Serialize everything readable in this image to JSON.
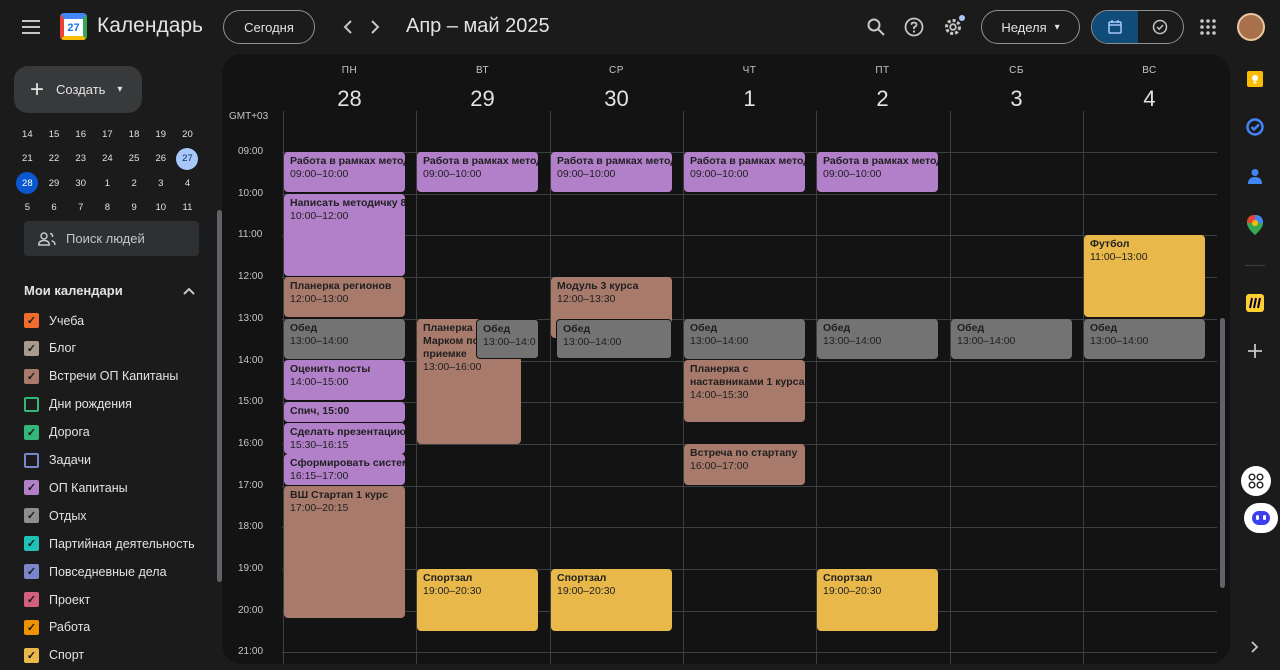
{
  "header": {
    "app_title": "Календарь",
    "logo_number": "27",
    "today_button": "Сегодня",
    "date_range": "Апр – май 2025",
    "view_button": "Неделя",
    "view_arrow": "▾"
  },
  "create_button": {
    "label": "Создать",
    "arrow": "▾"
  },
  "mini_calendar": {
    "rows": [
      [
        "14",
        "15",
        "16",
        "17",
        "18",
        "19",
        "20"
      ],
      [
        "21",
        "22",
        "23",
        "24",
        "25",
        "26",
        "27"
      ],
      [
        "28",
        "29",
        "30",
        "1",
        "2",
        "3",
        "4"
      ],
      [
        "5",
        "6",
        "7",
        "8",
        "9",
        "10",
        "11"
      ]
    ],
    "selected": "27",
    "today": "28"
  },
  "people_search": {
    "placeholder": "Поиск людей"
  },
  "my_calendars": {
    "title": "Мои календари",
    "items": [
      {
        "label": "Учеба",
        "color": "#ef6c2d",
        "checked": true
      },
      {
        "label": "Блог",
        "color": "#a79b8e",
        "checked": true
      },
      {
        "label": "Встречи ОП Капитаны",
        "color": "#a87a6c",
        "checked": true
      },
      {
        "label": "Дни рождения",
        "color": "#33b679",
        "checked": false
      },
      {
        "label": "Дорога",
        "color": "#33b679",
        "checked": true
      },
      {
        "label": "Задачи",
        "color": "#7986cb",
        "checked": false
      },
      {
        "label": "ОП Капитаны",
        "color": "#b180c9",
        "checked": true
      },
      {
        "label": "Отдых",
        "color": "#8e8e8e",
        "checked": true
      },
      {
        "label": "Партийная деятельность",
        "color": "#20c2b5",
        "checked": true
      },
      {
        "label": "Повседневные дела",
        "color": "#7986cb",
        "checked": true
      },
      {
        "label": "Проект",
        "color": "#d25f7e",
        "checked": true
      },
      {
        "label": "Работа",
        "color": "#f09300",
        "checked": true
      },
      {
        "label": "Спорт",
        "color": "#e8b84b",
        "checked": true
      }
    ]
  },
  "week": {
    "timezone": "GMT+03",
    "days": [
      {
        "name": "ПН",
        "date": "28"
      },
      {
        "name": "ВТ",
        "date": "29"
      },
      {
        "name": "СР",
        "date": "30"
      },
      {
        "name": "ЧТ",
        "date": "1"
      },
      {
        "name": "ПТ",
        "date": "2"
      },
      {
        "name": "СБ",
        "date": "3"
      },
      {
        "name": "ВС",
        "date": "4"
      }
    ],
    "hours": [
      "09:00",
      "10:00",
      "11:00",
      "12:00",
      "13:00",
      "14:00",
      "15:00",
      "16:00",
      "17:00",
      "18:00",
      "19:00",
      "20:00",
      "21:00"
    ]
  },
  "events": [
    {
      "day": 0,
      "title": "Работа в рамках метод",
      "time": "09:00–10:00",
      "color": "purple"
    },
    {
      "day": 0,
      "title": "Написать методичку 8",
      "time": "10:00–12:00",
      "color": "purple"
    },
    {
      "day": 0,
      "title": "Планерка регионов",
      "time": "12:00–13:00",
      "color": "brown"
    },
    {
      "day": 0,
      "title": "Обед",
      "time": "13:00–14:00",
      "color": "gray"
    },
    {
      "day": 0,
      "title": "Оценить посты",
      "time": "14:00–15:00",
      "color": "purple"
    },
    {
      "day": 0,
      "title": "Спич, 15:00",
      "time": "",
      "color": "purple"
    },
    {
      "day": 0,
      "title": "Сделать презентацию",
      "time": "15:30–16:15",
      "color": "purple"
    },
    {
      "day": 0,
      "title": "Сформировать систем",
      "time": "16:15–17:00",
      "color": "purple"
    },
    {
      "day": 0,
      "title": "ВШ Стартап 1 курс",
      "time": "17:00–20:15",
      "color": "brown"
    },
    {
      "day": 0,
      "title": "",
      "time": "",
      "color": "brown"
    },
    {
      "day": 1,
      "title": "Работа в рамках метод",
      "time": "09:00–10:00",
      "color": "purple"
    },
    {
      "day": 1,
      "title": "Планерка",
      "title2": "Марком по",
      "title3": "приемке",
      "time": "13:00–16:00",
      "color": "brown"
    },
    {
      "day": 1,
      "title": "Обед",
      "time": "13:00–14:0",
      "color": "gray"
    },
    {
      "day": 1,
      "title": "Спортзал",
      "time": "19:00–20:30",
      "color": "yellow"
    },
    {
      "day": 2,
      "title": "Работа в рамках метод",
      "time": "09:00–10:00",
      "color": "purple"
    },
    {
      "day": 2,
      "title": "Модуль 3 курса",
      "time": "12:00–13:30",
      "color": "brown"
    },
    {
      "day": 2,
      "title": "Обед",
      "time": "13:00–14:00",
      "color": "gray"
    },
    {
      "day": 2,
      "title": "Спортзал",
      "time": "19:00–20:30",
      "color": "yellow"
    },
    {
      "day": 3,
      "title": "Работа в рамках метод",
      "time": "09:00–10:00",
      "color": "purple"
    },
    {
      "day": 3,
      "title": "Обед",
      "time": "13:00–14:00",
      "color": "gray"
    },
    {
      "day": 3,
      "title": "Планерка с",
      "title2": "наставниками 1 курса",
      "time": "14:00–15:30",
      "color": "brown"
    },
    {
      "day": 3,
      "title": "Встреча по стартапу",
      "time": "16:00–17:00",
      "color": "brown"
    },
    {
      "day": 4,
      "title": "Работа в рамках метод",
      "time": "09:00–10:00",
      "color": "purple"
    },
    {
      "day": 4,
      "title": "Обед",
      "time": "13:00–14:00",
      "color": "gray"
    },
    {
      "day": 4,
      "title": "Спортзал",
      "time": "19:00–20:30",
      "color": "yellow"
    },
    {
      "day": 5,
      "title": "Обед",
      "time": "13:00–14:00",
      "color": "gray"
    },
    {
      "day": 6,
      "title": "Футбол",
      "time": "11:00–13:00",
      "color": "yellow"
    },
    {
      "day": 6,
      "title": "Обед",
      "time": "13:00–14:00",
      "color": "gray"
    }
  ],
  "side_panel": {
    "icons": [
      "keep-icon",
      "tasks-icon",
      "contacts-icon",
      "maps-icon",
      "miro-icon",
      "add-icon"
    ]
  }
}
